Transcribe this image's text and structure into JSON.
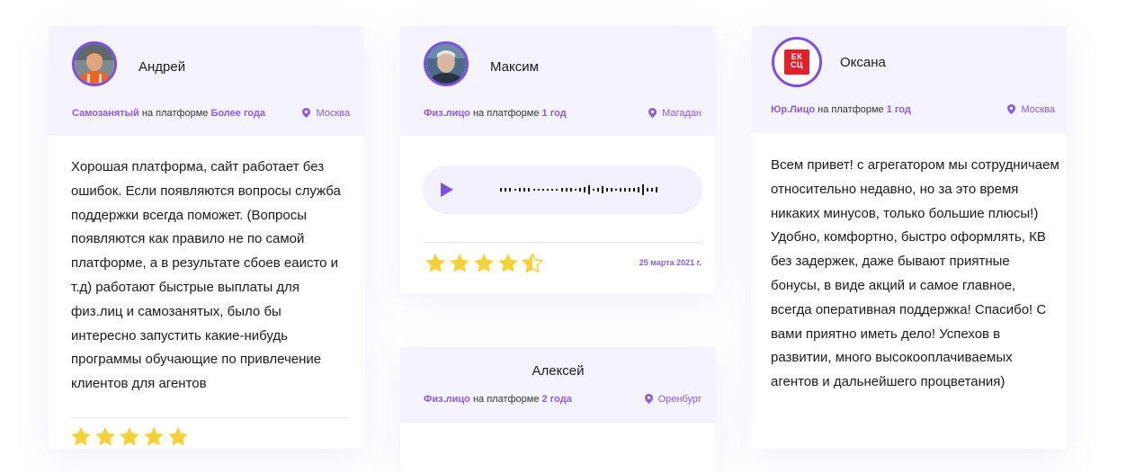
{
  "reviews": [
    {
      "name": "Андрей",
      "status": "Самозанятый",
      "platform_label": "на платформе",
      "duration": "Более года",
      "city": "Москва",
      "text": "Хорошая платформа, сайт работает без ошибок. Если появляются вопросы служба поддержки всегда поможет. (Вопросы появляются как правило не по самой платформе, а в результате сбоев еаисто и т.д) работают быстрые выплаты для физ.лиц и самозанятых, было бы интересно запустить какие-нибудь программы обучающие по привлечение клиентов для агентов",
      "rating": 5
    },
    {
      "name": "Максим",
      "status": "Физ.лицо",
      "platform_label": "на платформе",
      "duration": "1 год",
      "city": "Магадан",
      "rating": 4.5,
      "date": "25 марта 2021 г."
    },
    {
      "name": "Алексей",
      "status": "Физ.лицо",
      "platform_label": "на платформе",
      "duration": "2 года",
      "city": "Оренбург"
    },
    {
      "name": "Оксана",
      "status": "Юр.Лицо",
      "platform_label": "на платформе",
      "duration": "1 год",
      "city": "Москва",
      "logo_text": "ЕК СЦ",
      "text": "Всем привет! с агрегатором мы сотрудничаем относительно недавно, но за это время никаких минусов, только большие плюсы!) Удобно, комфортно, быстро оформлять, КВ без задержек, даже бывают приятные бонусы, в виде акций и самое главное, всегда оперативная поддержка! Спасибо! С вами приятно иметь дело! Успехов в развитии, много высокооплачиваемых агентов и дальнейшего процветания)"
    }
  ],
  "colors": {
    "accent": "#8a5be8",
    "star": "#f7d237",
    "card_bg": "#f4f3ff",
    "logo_red": "#e0202a"
  },
  "icons": {
    "location": "location-pin-icon",
    "play": "play-icon",
    "star": "star-icon",
    "star_half": "star-half-icon"
  }
}
